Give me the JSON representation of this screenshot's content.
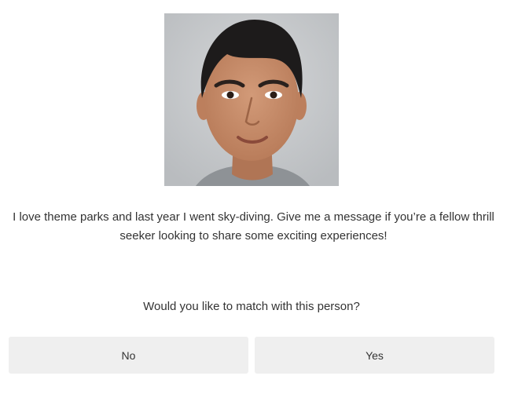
{
  "profile": {
    "photo_alt": "profile-photo",
    "bio": "I love theme parks and last year I went sky-diving. Give me a message if you’re a fellow thrill seeker looking to share some exciting experiences!"
  },
  "prompt": {
    "question": "Would you like to match with this person?"
  },
  "actions": {
    "no_label": "No",
    "yes_label": "Yes"
  },
  "colors": {
    "button_bg": "#efefef",
    "text": "#333333",
    "photo_bg": "#c9cbcd"
  }
}
